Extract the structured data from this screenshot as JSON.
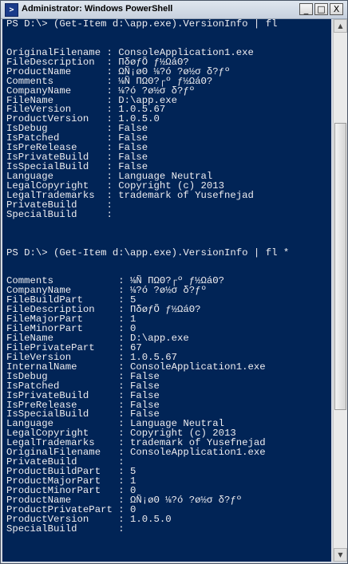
{
  "window": {
    "title": "Administrator: Windows PowerShell",
    "icon": "powershell-icon",
    "icon_glyph": ">",
    "controls": {
      "minimize": "_",
      "maximize": "□",
      "close": "X"
    }
  },
  "scrollbar": {
    "up_arrow": "▲",
    "down_arrow": "▼"
  },
  "console": {
    "lines": [
      "PS D:\\> (Get-Item d:\\app.exe).VersionInfo | fl",
      "",
      "",
      "OriginalFilename : ConsoleApplication1.exe",
      "FileDescription  : ΠδøƒÕ ƒ½ΩáΘ?",
      "ProductName      : ΩÑ¡øΘ ⅛?ó ?ø½σ δ?ƒº",
      "Comments         : ⅛Ñ ΠΩΘ?┌º ƒ½ΩáΘ?",
      "CompanyName      : ⅛?ó ?ø½σ δ?ƒº",
      "FileName         : D:\\app.exe",
      "FileVersion      : 1.0.5.67",
      "ProductVersion   : 1.0.5.0",
      "IsDebug          : False",
      "IsPatched        : False",
      "IsPreRelease     : False",
      "IsPrivateBuild   : False",
      "IsSpecialBuild   : False",
      "Language         : Language Neutral",
      "LegalCopyright   : Copyright (c) 2013",
      "LegalTrademarks  : trademark of Yusefnejad",
      "PrivateBuild     :",
      "SpecialBuild     :",
      "",
      "",
      "",
      "PS D:\\> (Get-Item d:\\app.exe).VersionInfo | fl *",
      "",
      "",
      "Comments           : ⅛Ñ ΠΩΘ?┌º ƒ½ΩáΘ?",
      "CompanyName        : ⅛?ó ?ø½σ δ?ƒº",
      "FileBuildPart      : 5",
      "FileDescription    : ΠδøƒÕ ƒ½ΩáΘ?",
      "FileMajorPart      : 1",
      "FileMinorPart      : 0",
      "FileName           : D:\\app.exe",
      "FilePrivatePart    : 67",
      "FileVersion        : 1.0.5.67",
      "InternalName       : ConsoleApplication1.exe",
      "IsDebug            : False",
      "IsPatched          : False",
      "IsPrivateBuild     : False",
      "IsPreRelease       : False",
      "IsSpecialBuild     : False",
      "Language           : Language Neutral",
      "LegalCopyright     : Copyright (c) 2013",
      "LegalTrademarks    : trademark of Yusefnejad",
      "OriginalFilename   : ConsoleApplication1.exe",
      "PrivateBuild       :",
      "ProductBuildPart   : 5",
      "ProductMajorPart   : 1",
      "ProductMinorPart   : 0",
      "ProductName        : ΩÑ¡øΘ ⅛?ó ?ø½σ δ?ƒº",
      "ProductPrivatePart : 0",
      "ProductVersion     : 1.0.5.0",
      "SpecialBuild       :"
    ]
  },
  "colors": {
    "console_background": "#012456",
    "console_text": "#eeedf0"
  }
}
